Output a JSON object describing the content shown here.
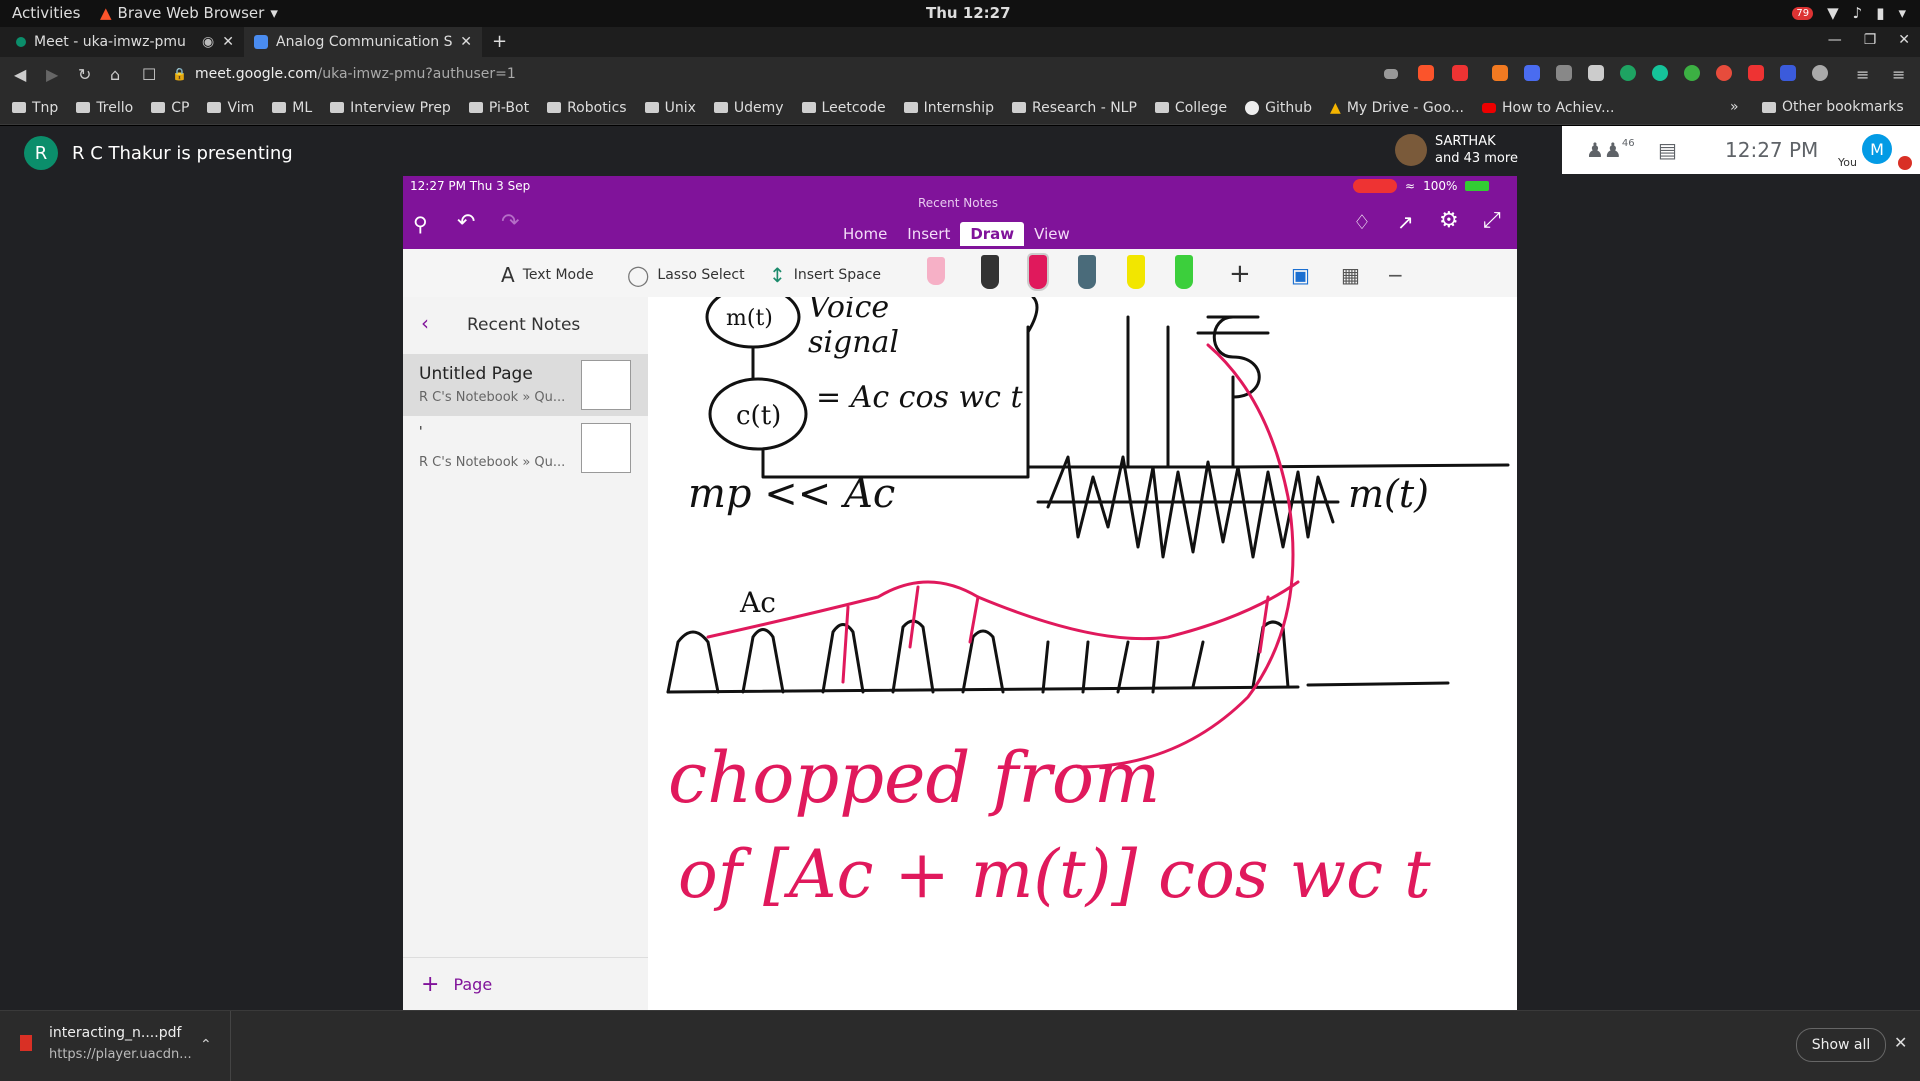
{
  "os_bar": {
    "activities": "Activities",
    "app_name": "Brave Web Browser",
    "clock": "Thu 12:27",
    "notification_badge": "79"
  },
  "tabs": [
    {
      "title": "Meet - uka-imwz-pmu",
      "active": false
    },
    {
      "title": "Analog Communication Sy",
      "active": true
    }
  ],
  "address": {
    "domain": "meet.google.com",
    "path": "/uka-imwz-pmu?authuser=1"
  },
  "bookmarks": [
    {
      "label": "Tnp"
    },
    {
      "label": "Trello"
    },
    {
      "label": "CP"
    },
    {
      "label": "Vim"
    },
    {
      "label": "ML"
    },
    {
      "label": "Interview Prep"
    },
    {
      "label": "Pi-Bot"
    },
    {
      "label": "Robotics"
    },
    {
      "label": "Unix"
    },
    {
      "label": "Udemy"
    },
    {
      "label": "Leetcode"
    },
    {
      "label": "Internship"
    },
    {
      "label": "Research - NLP"
    },
    {
      "label": "College"
    },
    {
      "label": "Github"
    },
    {
      "label": "My Drive - Goo..."
    },
    {
      "label": "How to Achiev..."
    }
  ],
  "bookmarks_more": "»",
  "other_bookmarks": "Other bookmarks",
  "meet": {
    "presenter_initial": "R",
    "presenter_text": "R C Thakur is presenting",
    "participant_name": "SARTHAK",
    "participant_more": "and 43 more",
    "people_count": "46",
    "time": "12:27 PM",
    "self_label": "You",
    "self_initial": "M"
  },
  "ipad": {
    "status_time": "12:27 PM   Thu 3 Sep",
    "battery": "100%",
    "header_title": "Recent Notes",
    "tabs": [
      "Home",
      "Insert",
      "Draw",
      "View"
    ],
    "active_tab": "Draw",
    "ribbon": {
      "text_mode": "Text Mode",
      "lasso": "Lasso Select",
      "insert_space": "Insert Space"
    },
    "sidebar_title": "Recent Notes",
    "notes": [
      {
        "title": "Untitled Page",
        "path": "R C's Notebook » Qu..."
      },
      {
        "title": "'",
        "path": "R C's Notebook » Qu..."
      }
    ],
    "add_page": "Page"
  },
  "handwriting": {
    "line1": "chopped from",
    "line2": "of [Ac + m(t)] cos wc t"
  },
  "download": {
    "filename": "interacting_n....pdf",
    "url": "https://player.uacdn...",
    "show_all": "Show all"
  },
  "colors": {
    "onenote_purple": "#80139a",
    "ink_red": "#e0195c",
    "meet_green": "#0b8e6b"
  }
}
